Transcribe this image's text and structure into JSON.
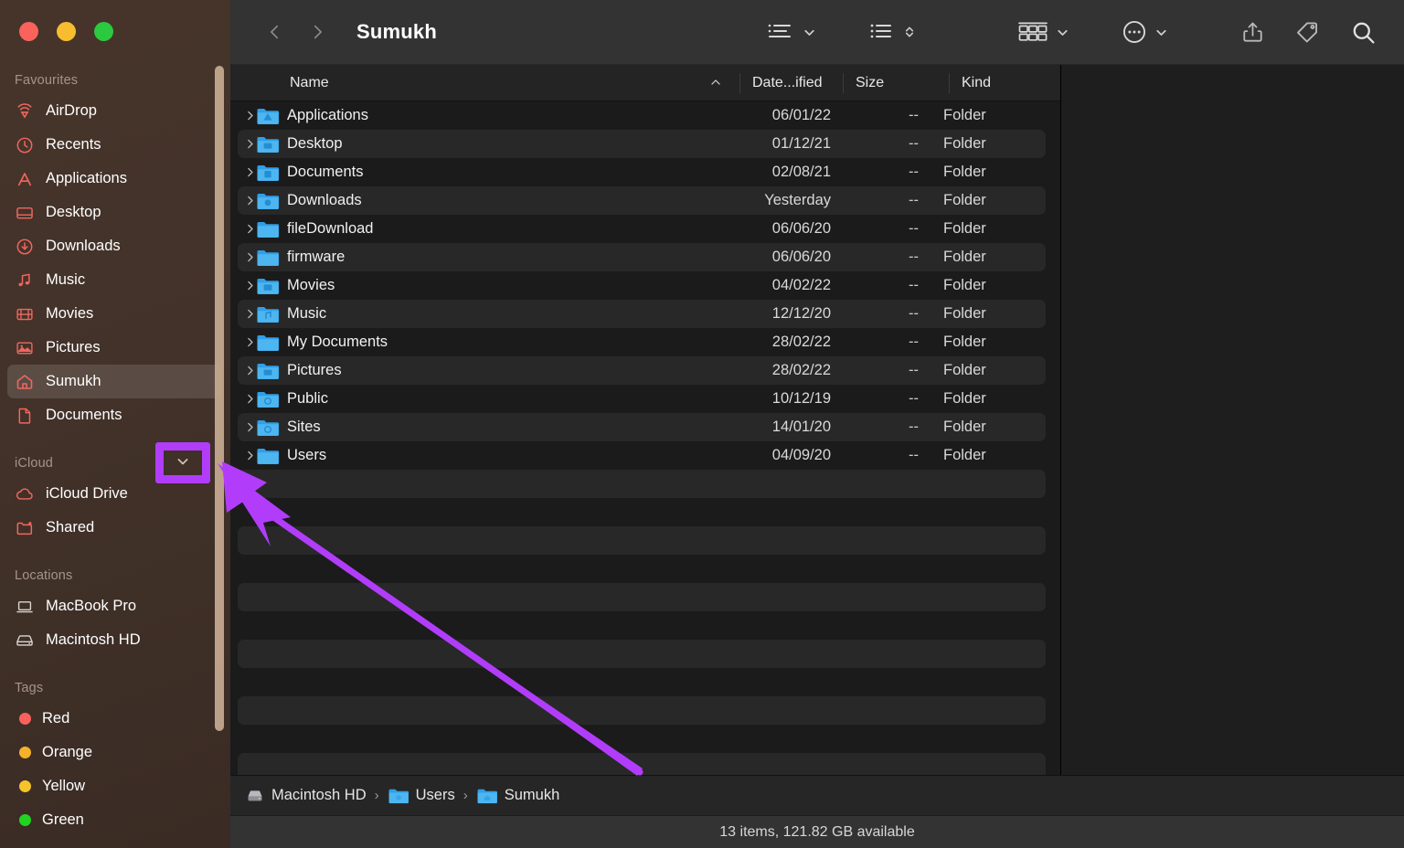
{
  "window": {
    "title": "Sumukh",
    "traffic_lights": [
      "close",
      "minimize",
      "zoom"
    ]
  },
  "toolbar": {
    "back_label": "Back",
    "forward_label": "Forward",
    "view_options_label": "View Options",
    "group_sort_label": "Group and Sort",
    "gallery_view_label": "Gallery View",
    "more_label": "More",
    "share_label": "Share",
    "tags_label": "Tags",
    "search_label": "Search"
  },
  "sidebar": {
    "scroll_position": "top",
    "groups": [
      {
        "title": "Favourites",
        "collapsible": true,
        "items": [
          {
            "label": "AirDrop",
            "icon": "airdrop-icon",
            "selected": false
          },
          {
            "label": "Recents",
            "icon": "clock-icon",
            "selected": false
          },
          {
            "label": "Applications",
            "icon": "applications-icon",
            "selected": false
          },
          {
            "label": "Desktop",
            "icon": "desktop-icon",
            "selected": false
          },
          {
            "label": "Downloads",
            "icon": "downloads-icon",
            "selected": false
          },
          {
            "label": "Music",
            "icon": "music-note-icon",
            "selected": false
          },
          {
            "label": "Movies",
            "icon": "film-icon",
            "selected": false
          },
          {
            "label": "Pictures",
            "icon": "picture-icon",
            "selected": false
          },
          {
            "label": "Sumukh",
            "icon": "home-icon",
            "selected": true
          },
          {
            "label": "Documents",
            "icon": "document-icon",
            "selected": false
          }
        ]
      },
      {
        "title": "iCloud",
        "collapsible": true,
        "collapse_button": "chevron-down-icon",
        "items": [
          {
            "label": "iCloud Drive",
            "icon": "cloud-icon",
            "selected": false
          },
          {
            "label": "Shared",
            "icon": "shared-folder-icon",
            "selected": false
          }
        ]
      },
      {
        "title": "Locations",
        "collapsible": true,
        "items": [
          {
            "label": "MacBook Pro",
            "icon": "laptop-icon",
            "selected": false
          },
          {
            "label": "Macintosh HD",
            "icon": "harddisk-icon",
            "selected": false
          }
        ]
      },
      {
        "title": "Tags",
        "collapsible": true,
        "items": [
          {
            "label": "Red",
            "icon": "tag-dot-icon",
            "color": "#f9625c"
          },
          {
            "label": "Orange",
            "icon": "tag-dot-icon",
            "color": "#f5b12a"
          },
          {
            "label": "Yellow",
            "icon": "tag-dot-icon",
            "color": "#f7c32b"
          },
          {
            "label": "Green",
            "icon": "tag-dot-icon",
            "color": "#22d422"
          }
        ]
      }
    ]
  },
  "file_list": {
    "columns": [
      {
        "key": "name",
        "label": "Name",
        "sorted": "ascending"
      },
      {
        "key": "date",
        "label": "Date...ified"
      },
      {
        "key": "size",
        "label": "Size"
      },
      {
        "key": "kind",
        "label": "Kind"
      }
    ],
    "rows": [
      {
        "name": "Applications",
        "date": "06/01/22",
        "size": "--",
        "kind": "Folder",
        "icon": "folder-applications-icon"
      },
      {
        "name": "Desktop",
        "date": "01/12/21",
        "size": "--",
        "kind": "Folder",
        "icon": "folder-desktop-icon"
      },
      {
        "name": "Documents",
        "date": "02/08/21",
        "size": "--",
        "kind": "Folder",
        "icon": "folder-documents-icon"
      },
      {
        "name": "Downloads",
        "date": "Yesterday",
        "size": "--",
        "kind": "Folder",
        "icon": "folder-downloads-icon"
      },
      {
        "name": "fileDownload",
        "date": "06/06/20",
        "size": "--",
        "kind": "Folder",
        "icon": "folder-icon"
      },
      {
        "name": "firmware",
        "date": "06/06/20",
        "size": "--",
        "kind": "Folder",
        "icon": "folder-icon"
      },
      {
        "name": "Movies",
        "date": "04/02/22",
        "size": "--",
        "kind": "Folder",
        "icon": "folder-movies-icon"
      },
      {
        "name": "Music",
        "date": "12/12/20",
        "size": "--",
        "kind": "Folder",
        "icon": "folder-music-icon"
      },
      {
        "name": "My Documents",
        "date": "28/02/22",
        "size": "--",
        "kind": "Folder",
        "icon": "folder-icon"
      },
      {
        "name": "Pictures",
        "date": "28/02/22",
        "size": "--",
        "kind": "Folder",
        "icon": "folder-pictures-icon"
      },
      {
        "name": "Public",
        "date": "10/12/19",
        "size": "--",
        "kind": "Folder",
        "icon": "folder-public-icon"
      },
      {
        "name": "Sites",
        "date": "14/01/20",
        "size": "--",
        "kind": "Folder",
        "icon": "folder-sites-icon"
      },
      {
        "name": "Users",
        "date": "04/09/20",
        "size": "--",
        "kind": "Folder",
        "icon": "folder-icon"
      }
    ]
  },
  "path_bar": {
    "crumbs": [
      {
        "label": "Macintosh HD",
        "icon": "harddisk-icon"
      },
      {
        "label": "Users",
        "icon": "folder-public-icon"
      },
      {
        "label": "Sumukh",
        "icon": "folder-home-icon"
      }
    ],
    "separator": "›"
  },
  "status_bar": {
    "text": "13 items, 121.82 GB available"
  },
  "annotation": {
    "highlight_color": "#b13dfb",
    "highlight_target": "icloud-collapse-chevron-button",
    "arrow": "purple-arrow-pointing-to-collapse-button"
  }
}
